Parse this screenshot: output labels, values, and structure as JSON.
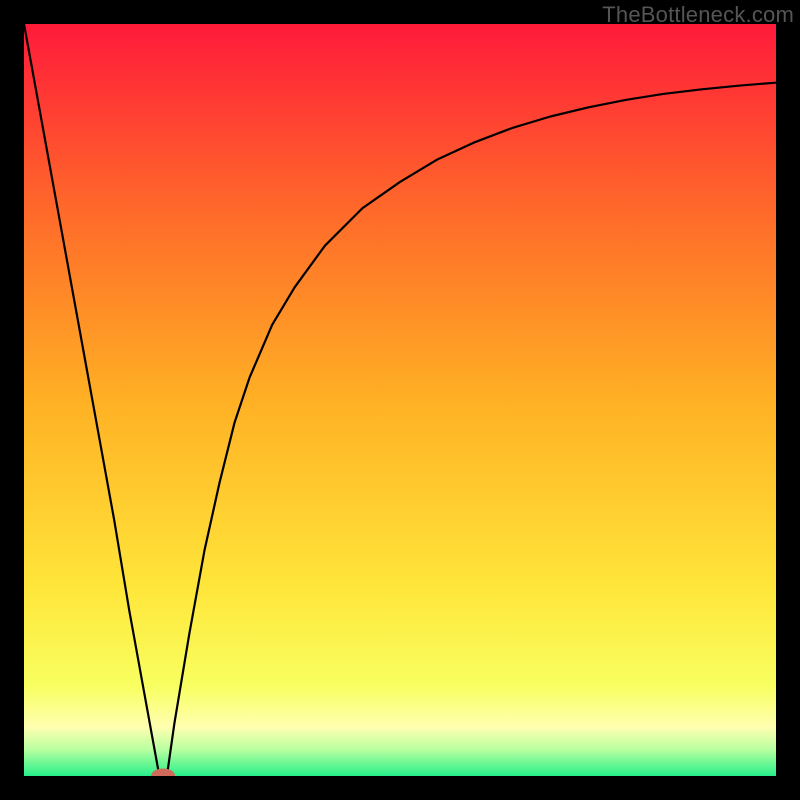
{
  "watermark": "TheBottleneck.com",
  "chart_data": {
    "type": "line",
    "title": "",
    "xlabel": "",
    "ylabel": "",
    "xlim": [
      0,
      100
    ],
    "ylim": [
      0,
      100
    ],
    "grid": false,
    "legend": false,
    "annotations": [],
    "background_gradient": {
      "stops": [
        {
          "pos": 0.0,
          "color": "#ff1a3a"
        },
        {
          "pos": 0.25,
          "color": "#ff6a2a"
        },
        {
          "pos": 0.5,
          "color": "#ffb024"
        },
        {
          "pos": 0.75,
          "color": "#ffe63a"
        },
        {
          "pos": 0.88,
          "color": "#f8ff60"
        },
        {
          "pos": 0.935,
          "color": "#ffffb0"
        },
        {
          "pos": 0.965,
          "color": "#b8ffa0"
        },
        {
          "pos": 1.0,
          "color": "#26f08a"
        }
      ]
    },
    "series": [
      {
        "name": "bottleneck-curve",
        "stroke": "#000000",
        "stroke_width": 2.2,
        "x": [
          0,
          2,
          4,
          6,
          8,
          10,
          12,
          14,
          16,
          17,
          18,
          19,
          20,
          22,
          24,
          26,
          28,
          30,
          33,
          36,
          40,
          45,
          50,
          55,
          60,
          65,
          70,
          75,
          80,
          85,
          90,
          95,
          100
        ],
        "y": [
          100,
          89,
          78,
          67,
          56,
          45,
          34,
          22,
          11,
          5.5,
          0,
          0,
          7,
          19,
          30,
          39,
          47,
          53,
          60,
          65,
          70.5,
          75.5,
          79,
          82,
          84.3,
          86.2,
          87.7,
          88.9,
          89.9,
          90.7,
          91.3,
          91.8,
          92.2
        ]
      }
    ],
    "marker": {
      "name": "optimum-marker",
      "cx": 18.5,
      "cy": 0,
      "rx": 1.6,
      "ry": 1.0,
      "fill": "#d06a5a"
    }
  }
}
